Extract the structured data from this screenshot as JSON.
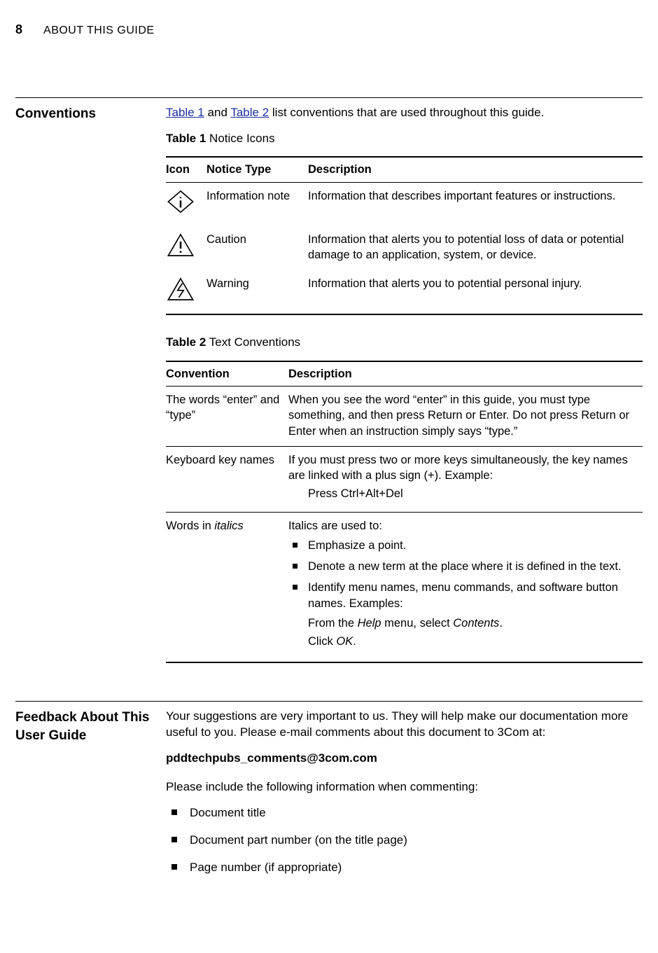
{
  "header": {
    "page_num": "8",
    "page_title": "ABOUT THIS GUIDE"
  },
  "conventions": {
    "heading": "Conventions",
    "intro_before": "",
    "link1": "Table 1",
    "mid1": " and ",
    "link2": "Table 2",
    "intro_after": " list conventions that are used throughout this guide.",
    "table1_caption_b": "Table 1",
    "table1_caption": "   Notice Icons",
    "table1": {
      "h_icon": "Icon",
      "h_type": "Notice Type",
      "h_desc": "Description",
      "rows": [
        {
          "type": "Information note",
          "desc": "Information that describes important features or instructions."
        },
        {
          "type": "Caution",
          "desc": "Information that alerts you to potential loss of data or potential damage to an application, system, or device."
        },
        {
          "type": "Warning",
          "desc": "Information that alerts you to potential personal injury."
        }
      ]
    },
    "table2_caption_b": "Table 2",
    "table2_caption": "   Text Conventions",
    "table2": {
      "h_conv": "Convention",
      "h_desc": "Description",
      "r0": {
        "conv": "The words “enter” and “type”",
        "desc": "When you see the word “enter” in this guide, you must type something, and then press Return or Enter. Do not press Return or Enter when an instruction simply says “type.”"
      },
      "r1": {
        "conv": "Keyboard key names",
        "desc": "If you must press two or more keys simultaneously, the key names are linked with a plus sign (+). Example:",
        "example": "Press Ctrl+Alt+Del"
      },
      "r2": {
        "conv_a": "Words in ",
        "conv_i": "italics",
        "lead": "Italics are used to:",
        "b1": "Emphasize a point.",
        "b2": "Denote a new term at the place where it is defined in the text.",
        "b3": "Identify menu names, menu commands, and software button names. Examples:",
        "ex1_a": "From the ",
        "ex1_i1": "Help",
        "ex1_b": " menu, select ",
        "ex1_i2": "Contents",
        "ex1_c": ".",
        "ex2_a": "Click ",
        "ex2_i": "OK",
        "ex2_b": "."
      }
    }
  },
  "feedback": {
    "heading": "Feedback About This User Guide",
    "p1": "Your suggestions are very important to us. They will help make our documentation more useful to you. Please e-mail comments about this document to 3Com at:",
    "email": "pddtechpubs_comments@3com.com",
    "p2": "Please include the following information when commenting:",
    "items": [
      "Document title",
      "Document part number (on the title page)",
      "Page number (if appropriate)"
    ]
  }
}
